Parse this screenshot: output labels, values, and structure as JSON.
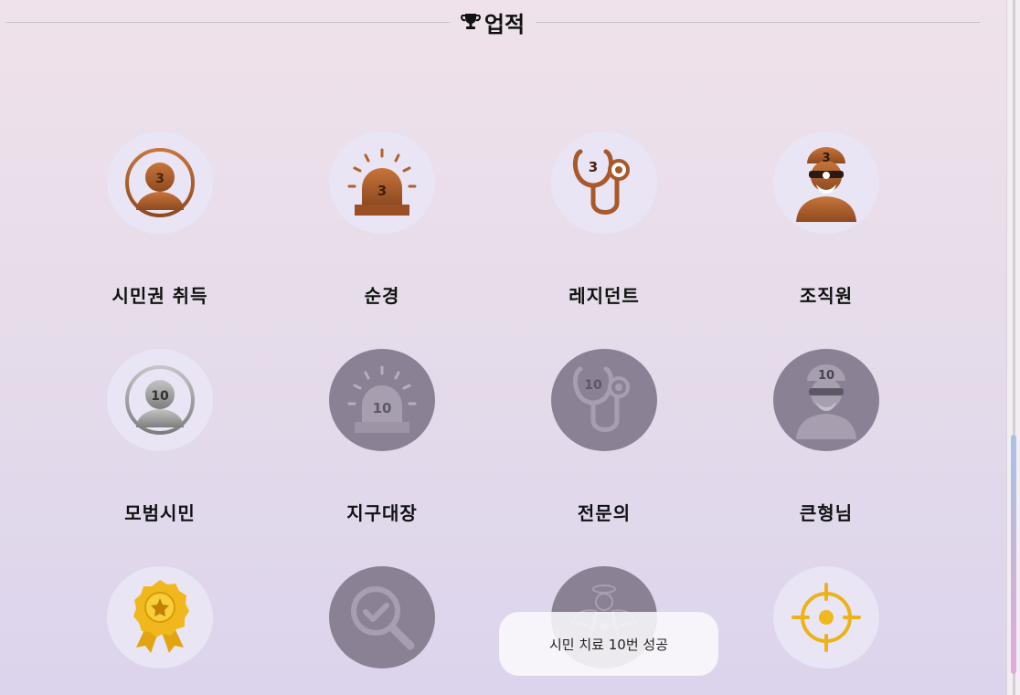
{
  "header": {
    "title": "업적",
    "icon": "trophy-icon"
  },
  "achievements": [
    {
      "label": "시민권 취득",
      "icon": "person-icon",
      "badge": "3",
      "tier": "bronze"
    },
    {
      "label": "순경",
      "icon": "siren-icon",
      "badge": "3",
      "tier": "bronze"
    },
    {
      "label": "레지던트",
      "icon": "stethoscope-icon",
      "badge": "3",
      "tier": "bronze"
    },
    {
      "label": "조직원",
      "icon": "gangster-icon",
      "badge": "3",
      "tier": "bronze"
    },
    {
      "label": "모범시민",
      "icon": "person-icon",
      "badge": "10",
      "tier": "silver"
    },
    {
      "label": "지구대장",
      "icon": "siren-icon",
      "badge": "10",
      "tier": "locked"
    },
    {
      "label": "전문의",
      "icon": "stethoscope-icon",
      "badge": "10",
      "tier": "locked"
    },
    {
      "label": "큰형님",
      "icon": "gangster-icon",
      "badge": "10",
      "tier": "locked"
    },
    {
      "label": "",
      "icon": "award-ribbon-icon",
      "badge": "",
      "tier": "gold"
    },
    {
      "label": "",
      "icon": "magnifier-check-icon",
      "badge": "",
      "tier": "locked"
    },
    {
      "label": "",
      "icon": "angel-icon",
      "badge": "",
      "tier": "locked"
    },
    {
      "label": "",
      "icon": "crosshair-icon",
      "badge": "",
      "tier": "gold"
    }
  ],
  "toast": {
    "message": "시민 치료 10번 성공"
  },
  "colors": {
    "bronze": "#b2602c",
    "silver": "#9a9a9a",
    "gold": "#f0b81c",
    "locked": "#8a8195"
  }
}
